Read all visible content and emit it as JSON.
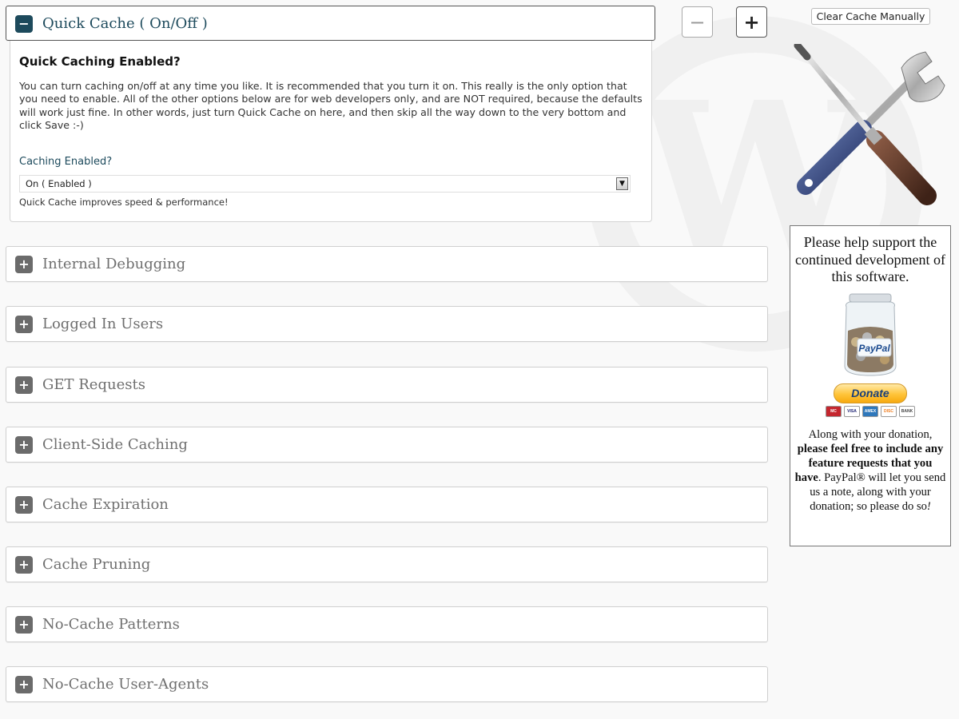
{
  "controls": {
    "collapse_all": "−",
    "expand_all": "+",
    "clear_cache": "Clear Cache Manually"
  },
  "open_panel": {
    "title": "Quick Cache ( On/Off )",
    "toggle": "−",
    "heading": "Quick Caching Enabled?",
    "description": "You can turn caching on/off at any time you like. It is recommended that you turn it on. This really is the only option that you need to enable. All of the other options below are for web developers only, and are NOT required, because the defaults will work just fine. In other words, just turn Quick Cache on here, and then skip all the way down to the very bottom and click Save :-)",
    "field_label": "Caching Enabled?",
    "select_value": "On ( Enabled )",
    "select_arrow": "▼",
    "field_note": "Quick Cache improves speed & performance!"
  },
  "panels": [
    {
      "title": "Internal Debugging",
      "toggle": "+"
    },
    {
      "title": "Logged In Users",
      "toggle": "+"
    },
    {
      "title": "GET Requests",
      "toggle": "+"
    },
    {
      "title": "Client-Side Caching",
      "toggle": "+"
    },
    {
      "title": "Cache Expiration",
      "toggle": "+"
    },
    {
      "title": "Cache Pruning",
      "toggle": "+"
    },
    {
      "title": "No-Cache Patterns",
      "toggle": "+"
    },
    {
      "title": "No-Cache User-Agents",
      "toggle": "+"
    }
  ],
  "sidebar": {
    "illustration": "screwdriver-wrench-icon",
    "donate_heading": "Please help support the continued development of this software.",
    "jar_label": "PayPal",
    "donate_button": "Donate",
    "cards": [
      "MC",
      "VISA",
      "AMEX",
      "DISC",
      "BANK"
    ],
    "text_1": "Along with your donation,",
    "text_bold": "please feel free to include any feature requests that you have",
    "text_2": ". PayPal® will let you send us a note, along with your donation; so please do so",
    "text_3": "!"
  },
  "colors": {
    "accent": "#1d4a5c",
    "toggle_gray": "#6b6b6b",
    "panel_title_gray": "#6f6f6f",
    "background": "#f9f9f9"
  }
}
